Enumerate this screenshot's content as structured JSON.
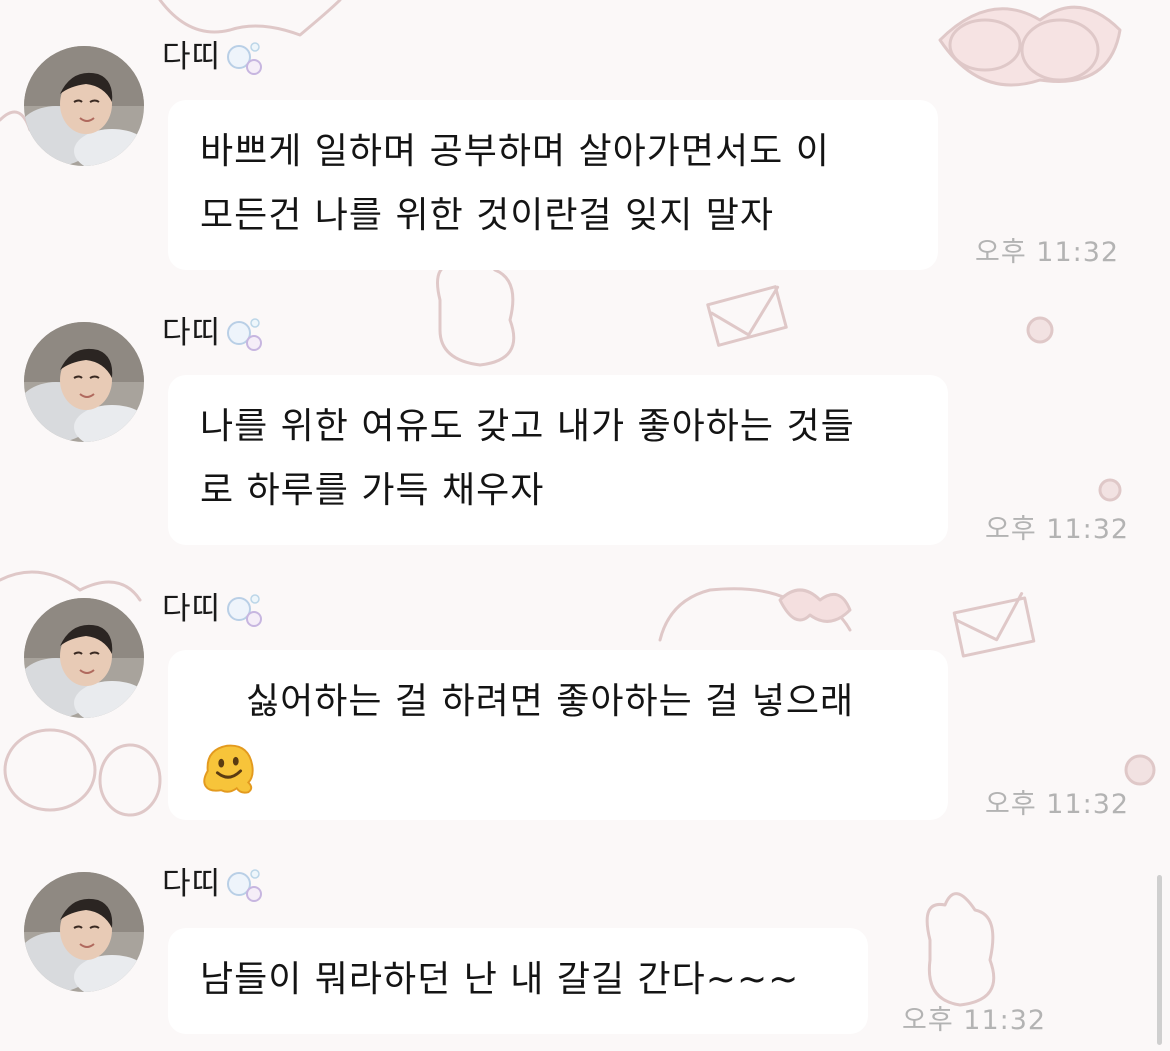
{
  "chat": {
    "messages": [
      {
        "sender": "다띠",
        "lines": [
          "바쁘게 일하며 공부하며 살아가면서도 이",
          "모든건 나를 위한 것이란걸 잊지 말자"
        ],
        "time": "오후 11:32"
      },
      {
        "sender": "다띠",
        "lines": [
          "나를 위한 여유도 갖고 내가 좋아하는 것들",
          "로 하루를 가득 채우자"
        ],
        "time": "오후 11:32"
      },
      {
        "sender": "다띠",
        "lines": [
          "싫어하는 걸 하려면 좋아하는 걸 넣으래"
        ],
        "emoji": "melting-face-emoji",
        "time": "오후 11:32"
      },
      {
        "sender": "다띠",
        "lines": [
          "남들이 뭐라하던 난 내 갈길 간다~~~"
        ],
        "time": "오후 11:32"
      }
    ]
  },
  "colors": {
    "background": "#fbf8f8",
    "bubble": "#ffffff",
    "timestamp": "#b3b3b3",
    "wallpaper_doodle": "#e2b8b8"
  }
}
